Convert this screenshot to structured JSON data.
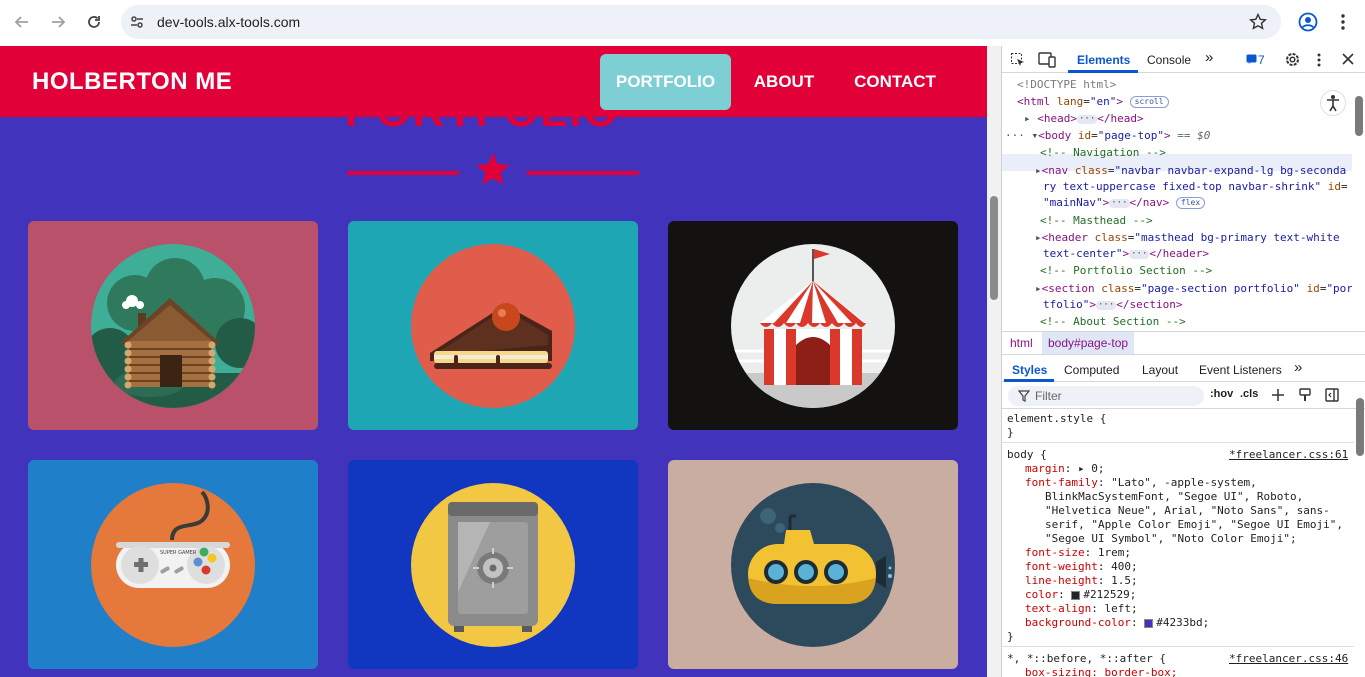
{
  "browser": {
    "url": "dev-tools.alx-tools.com"
  },
  "site": {
    "brand": "HOLBERTON ME",
    "nav": [
      "PORTFOLIO",
      "ABOUT",
      "CONTACT"
    ],
    "heading": "PORTFOLIO",
    "tiles": [
      {
        "name": "cabin",
        "bg": "#b85169"
      },
      {
        "name": "cake",
        "bg": "#1fa6b5"
      },
      {
        "name": "circus",
        "bg": "#141111"
      },
      {
        "name": "game-controller",
        "bg": "#1f7fc8"
      },
      {
        "name": "safe",
        "bg": "#1136c0"
      },
      {
        "name": "submarine",
        "bg": "#c9ada1"
      }
    ]
  },
  "devtools": {
    "tabs": [
      "Elements",
      "Console"
    ],
    "issues_count": "7",
    "dom": {
      "doctype": "<!DOCTYPE html>",
      "html_open": "<html",
      "html_attr": "lang",
      "html_val": "\"en\"",
      "html_close": ">",
      "scroll_pill": "scroll",
      "head_open": "<head>",
      "head_close": "</head>",
      "body_open": "<body",
      "body_attr": "id",
      "body_val": "\"page-top\"",
      "body_close": ">",
      "eq_zero": "== $0",
      "c_nav": "<!-- Navigation -->",
      "nav_open": "<nav",
      "nav_attr1": "class",
      "nav_val1a": "\"navbar navbar-expand-lg bg-seconda",
      "nav_val1b": "ry text-uppercase fixed-top navbar-shrink\"",
      "nav_attr2": "id",
      "nav_val2": "\"mainNav\"",
      "nav_close": "</nav>",
      "flex_pill": "flex",
      "c_masthead": "<!-- Masthead -->",
      "header_open": "<header",
      "header_attr": "class",
      "header_val1": "\"masthead bg-primary text-white",
      "header_val2": "text-center\"",
      "header_close": "</header>",
      "c_portfolio": "<!-- Portfolio Section -->",
      "section_open": "<section",
      "section_attr1": "class",
      "section_val1": "\"page-section portfolio\"",
      "section_attr2": "id",
      "section_val2a": "\"por",
      "section_val2b": "tfolio\"",
      "section_close": "</section>",
      "c_about": "<!-- About Section -->"
    },
    "breadcrumbs": [
      "html",
      "body#page-top"
    ],
    "sub_tabs": [
      "Styles",
      "Computed",
      "Layout",
      "Event Listeners"
    ],
    "filter_placeholder": "Filter",
    "hov": ":hov",
    "cls": ".cls",
    "styles": {
      "element_style": "element.style {",
      "close_brace": "}",
      "body_selector": "body {",
      "body_source": "*freelancer.css:61",
      "rules": [
        {
          "prop": "margin",
          "value": "0;",
          "arrow": true
        },
        {
          "prop": "font-family",
          "value": "\"Lato\", -apple-system,"
        },
        {
          "prop": "",
          "value": "BlinkMacSystemFont, \"Segoe UI\", Roboto,"
        },
        {
          "prop": "",
          "value": "\"Helvetica Neue\", Arial, \"Noto Sans\", sans-"
        },
        {
          "prop": "",
          "value": "serif, \"Apple Color Emoji\", \"Segoe UI Emoji\","
        },
        {
          "prop": "",
          "value": "\"Segoe UI Symbol\", \"Noto Color Emoji\";"
        },
        {
          "prop": "font-size",
          "value": "1rem;"
        },
        {
          "prop": "font-weight",
          "value": "400;"
        },
        {
          "prop": "line-height",
          "value": "1.5;"
        },
        {
          "prop": "color",
          "value": "#212529;",
          "swatch": "#212529"
        },
        {
          "prop": "text-align",
          "value": "left;"
        },
        {
          "prop": "background-color",
          "value": "#4233bd;",
          "swatch": "#4233bd"
        }
      ],
      "universal_selector": "*, *::before, *::after {",
      "universal_source": "*freelancer.css:46",
      "partial_prop": "box-sizing: border-box;"
    }
  },
  "colors": {
    "nav_red": "#e10037",
    "page_bg": "#4233bd",
    "active_nav": "#7dcfd4",
    "devtools_blue": "#0b57d0"
  }
}
